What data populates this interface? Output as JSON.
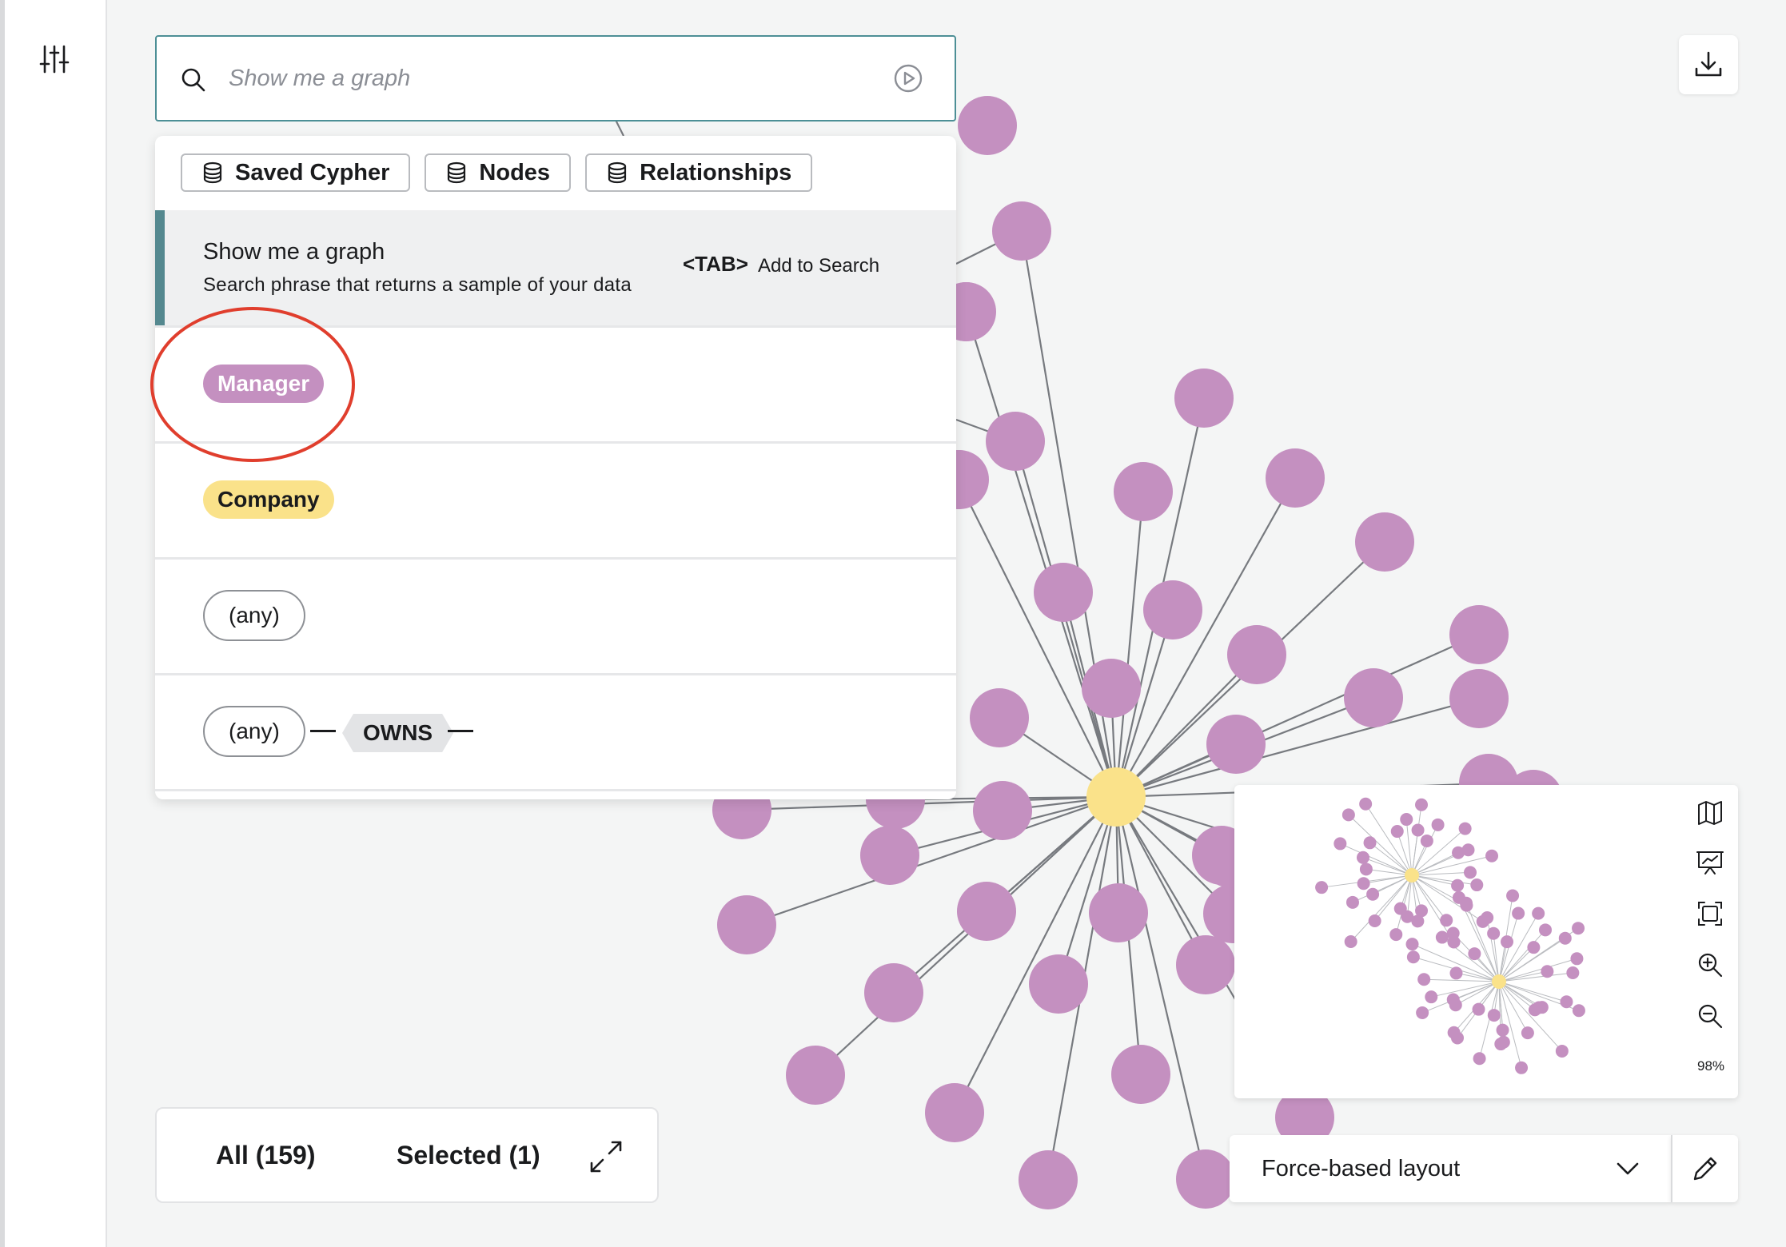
{
  "sidebar": {
    "filter_icon": "sliders-icon"
  },
  "search": {
    "placeholder": "Show me a graph",
    "search_icon": "search-icon",
    "run_icon": "play-circle-icon"
  },
  "dropdown": {
    "chips": [
      {
        "label": "Saved Cypher",
        "icon": "database-icon"
      },
      {
        "label": "Nodes",
        "icon": "database-icon"
      },
      {
        "label": "Relationships",
        "icon": "database-icon"
      }
    ],
    "suggestion": {
      "title": "Show me a graph",
      "description": "Search phrase that returns a sample of your data",
      "key_hint": "<TAB>",
      "action": "Add to Search"
    },
    "node_labels": [
      {
        "label": "Manager",
        "color": "#c490c0"
      },
      {
        "label": "Company",
        "color": "#fae28a"
      }
    ],
    "any_node": "(any)",
    "pattern": {
      "start": "(any)",
      "relationship": "OWNS"
    }
  },
  "toolbar": {
    "export_icon": "download-icon"
  },
  "results": {
    "all_label": "All (159)",
    "selected_label": "Selected (1)",
    "expand_icon": "expand-icon"
  },
  "minimap": {
    "buttons": [
      "map-icon",
      "presentation-icon",
      "fit-screen-icon",
      "zoom-in-icon",
      "zoom-out-icon"
    ],
    "zoom": "98%"
  },
  "layout": {
    "selected": "Force-based layout",
    "chevron_icon": "chevron-down-icon",
    "edit_icon": "pencil-icon"
  },
  "colors": {
    "manager_node": "#c490c0",
    "company_node": "#fae28a",
    "accent": "#4d8f96",
    "annotation_circle": "#e03e2d"
  }
}
